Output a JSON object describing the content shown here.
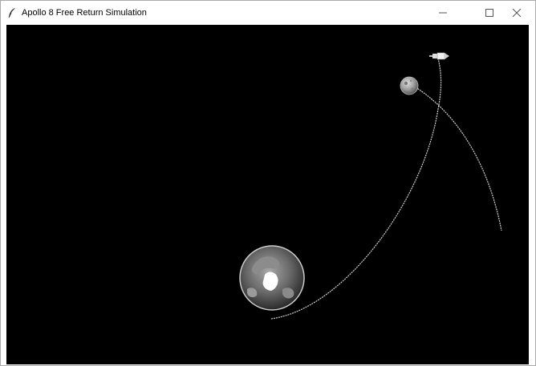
{
  "window": {
    "title": "Apollo 8 Free Return Simulation",
    "app_icon": "feather-icon",
    "controls": {
      "minimize_icon": "minimize-icon",
      "maximize_icon": "maximize-icon",
      "close_icon": "close-icon"
    }
  },
  "scene": {
    "background_color": "#000000",
    "trajectory_color": "#d0d0d0",
    "bodies": [
      {
        "name": "earth",
        "icon": "earth-icon"
      },
      {
        "name": "moon",
        "icon": "moon-icon"
      },
      {
        "name": "spacecraft",
        "icon": "spacecraft-icon"
      }
    ]
  }
}
